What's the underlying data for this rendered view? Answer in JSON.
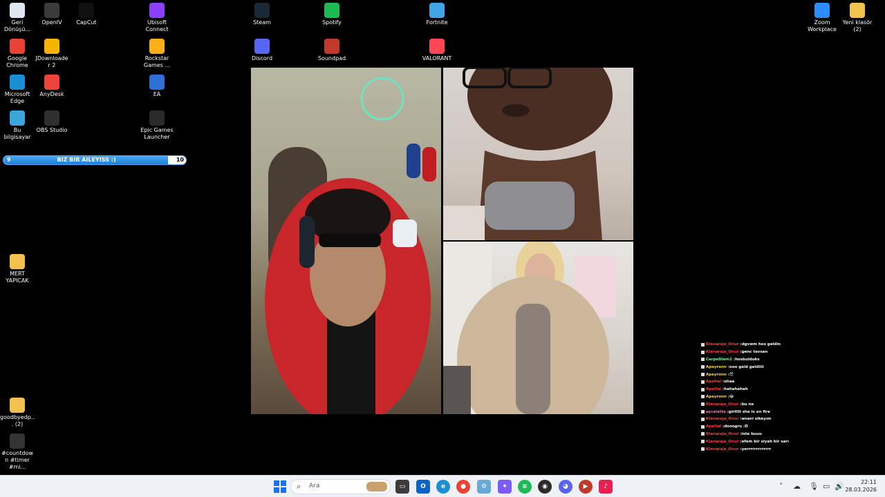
{
  "desktop_icons": [
    {
      "label": "Geri Dönüşü...",
      "icon": "recycle-bin-icon",
      "color": "#dfe8f2"
    },
    {
      "label": "OpenIV",
      "icon": "openiv-icon",
      "color": "#3b3b3b"
    },
    {
      "label": "CapCut",
      "icon": "capcut-icon",
      "color": "#111111"
    },
    {
      "label": "Ubisoft Connect",
      "icon": "ubisoft-icon",
      "color": "#8a3ffc"
    },
    {
      "label": "Steam",
      "icon": "steam-icon",
      "color": "#1b2838"
    },
    {
      "label": "Spotify",
      "icon": "spotify-icon",
      "color": "#1db954"
    },
    {
      "label": "Fortnite",
      "icon": "fortnite-icon",
      "color": "#3fa7e8"
    },
    {
      "label": "Zoom Workplace",
      "icon": "zoom-icon",
      "color": "#2d8cff"
    },
    {
      "label": "Yeni klasör (2)",
      "icon": "folder-icon",
      "color": "#f2c14e"
    },
    {
      "label": "Google Chrome",
      "icon": "chrome-icon",
      "color": "#e84335"
    },
    {
      "label": "JDownloader 2",
      "icon": "jdownloader-icon",
      "color": "#f7b500"
    },
    {
      "label": "Rockstar Games ...",
      "icon": "rockstar-icon",
      "color": "#fcaf17"
    },
    {
      "label": "Discord",
      "icon": "discord-icon",
      "color": "#5865f2"
    },
    {
      "label": "Soundpad",
      "icon": "soundpad-icon",
      "color": "#c0392b"
    },
    {
      "label": "VALORANT",
      "icon": "valorant-icon",
      "color": "#ff4655"
    },
    {
      "label": "Microsoft Edge",
      "icon": "edge-icon",
      "color": "#1a8fd6"
    },
    {
      "label": "AnyDesk",
      "icon": "anydesk-icon",
      "color": "#ef443b"
    },
    {
      "label": "EA",
      "icon": "ea-icon",
      "color": "#2f6fd6"
    },
    {
      "label": "Bu bilgisayar",
      "icon": "computer-icon",
      "color": "#3aa6d9"
    },
    {
      "label": "OBS Studio",
      "icon": "obs-icon",
      "color": "#302e31"
    },
    {
      "label": "Epic Games Launcher",
      "icon": "epic-games-icon",
      "color": "#2a2a2a"
    },
    {
      "label": "MERT YAPICAK",
      "icon": "folder-icon",
      "color": "#f2c14e"
    },
    {
      "label": "goodbyedp... (2)",
      "icon": "folder-icon",
      "color": "#f2c14e"
    },
    {
      "label": "#countdown #timer #mi...",
      "icon": "file-icon",
      "color": "#333333"
    }
  ],
  "progress": {
    "start": "9",
    "text": "BIZ BIR AILEYISS :)",
    "end": "10",
    "fraction": 0.9
  },
  "chat": [
    {
      "user": "Klanaraja_Onur",
      "msg": "dgvwm hos geldin",
      "color": "#ff3b3b"
    },
    {
      "user": "Klanaraja_Onur",
      "msg": "genc tavsan",
      "color": "#ff3b3b"
    },
    {
      "user": "CarpeDiem2",
      "msg": "hosbulduks",
      "color": "#5cff8a"
    },
    {
      "user": "Apeyronn",
      "msg": "ooo geld geldiiii",
      "color": "#ffd54a"
    },
    {
      "user": "Apeyronn",
      "msg": "😈",
      "color": "#ffd54a"
    },
    {
      "user": "Apeltal",
      "msg": "ohaa",
      "color": "#ff3b3b"
    },
    {
      "user": "Apeltal",
      "msg": "hahahahah",
      "color": "#ff3b3b"
    },
    {
      "user": "Apeyronn",
      "msg": "😂",
      "color": "#ffd54a"
    },
    {
      "user": "Klanaraja_Onur",
      "msg": "bu ne",
      "color": "#ff3b3b"
    },
    {
      "user": "aycalatte",
      "msg": "girlllll she is on fire",
      "color": "#ff6fb0"
    },
    {
      "user": "Klanaraja_Onur",
      "msg": "anani sikeyım",
      "color": "#ff3b3b"
    },
    {
      "user": "Apeltal",
      "msg": "dooogru :D",
      "color": "#ff3b3b"
    },
    {
      "user": "Klanaraja_Onur",
      "msg": "iste buuu",
      "color": "#ff3b3b"
    },
    {
      "user": "Klanaraja_Onur",
      "msg": "efem bir siyah bir sarı",
      "color": "#ff3b3b"
    },
    {
      "user": "Klanaraja_Onur",
      "msg": "yerrrrrrrrrrrrr",
      "color": "#ff3b3b"
    }
  ],
  "taskbar": {
    "search_placeholder": "Ara",
    "time": "22:11",
    "date": "28.03.2026"
  }
}
